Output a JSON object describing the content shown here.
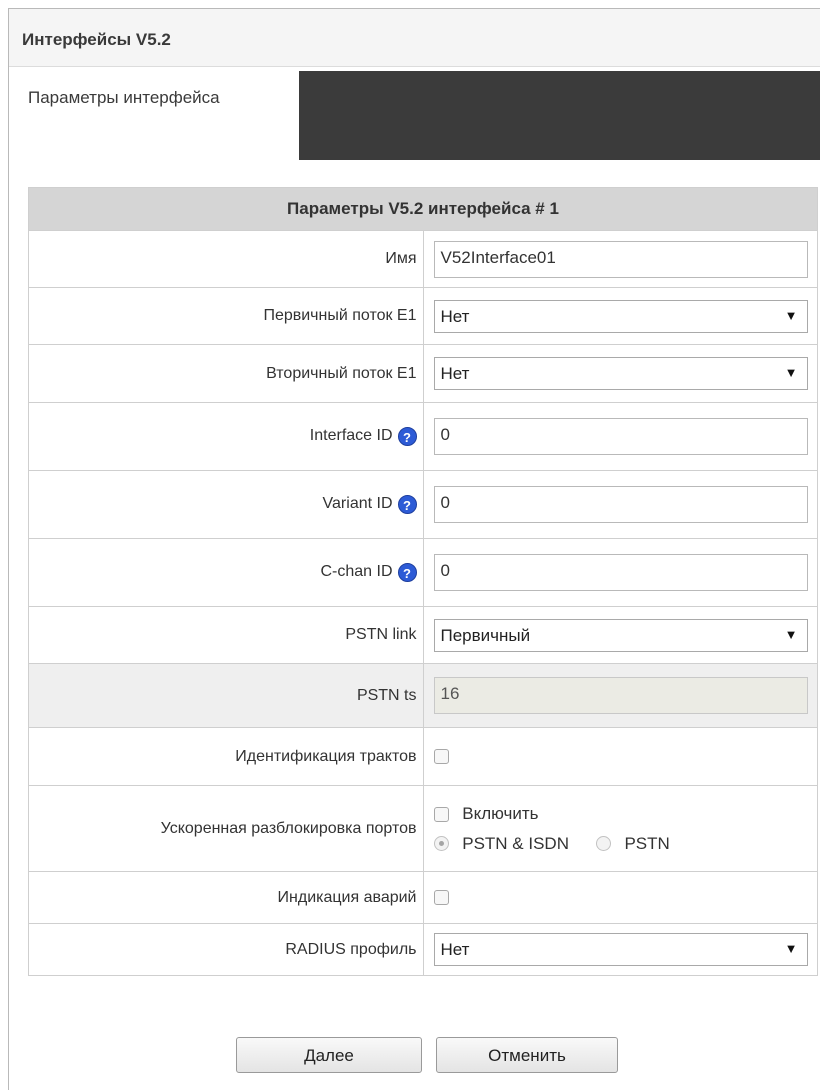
{
  "page": {
    "title": "Интерфейсы V5.2",
    "tab_active": "Параметры интерфейса"
  },
  "form": {
    "header": "Параметры V5.2 интерфейса # 1",
    "name": {
      "label": "Имя",
      "value": "V52Interface01"
    },
    "primary_e1": {
      "label": "Первичный поток E1",
      "value": "Нет"
    },
    "secondary_e1": {
      "label": "Вторичный поток E1",
      "value": "Нет"
    },
    "interface_id": {
      "label": "Interface ID",
      "value": "0"
    },
    "variant_id": {
      "label": "Variant ID",
      "value": "0"
    },
    "cchan_id": {
      "label": "C-chan ID",
      "value": "0"
    },
    "pstn_link": {
      "label": "PSTN link",
      "value": "Первичный"
    },
    "pstn_ts": {
      "label": "PSTN ts",
      "value": "16"
    },
    "path_ident": {
      "label": "Идентификация трактов",
      "checked": false
    },
    "fast_unblock": {
      "label": "Ускоренная разблокировка портов",
      "enable_label": "Включить",
      "enabled": false,
      "options": [
        "PSTN & ISDN",
        "PSTN"
      ],
      "selected": "PSTN & ISDN"
    },
    "alarm_indication": {
      "label": "Индикация аварий",
      "checked": false
    },
    "radius_profile": {
      "label": "RADIUS профиль",
      "value": "Нет"
    }
  },
  "buttons": {
    "next": "Далее",
    "cancel": "Отменить"
  },
  "icons": {
    "help": "help-icon",
    "dropdown": "dropdown-arrow-icon"
  },
  "colors": {
    "header_bg": "#d5d5d5",
    "tab_dark": "#3b3b3b",
    "help_icon": "#2d5bd6"
  }
}
